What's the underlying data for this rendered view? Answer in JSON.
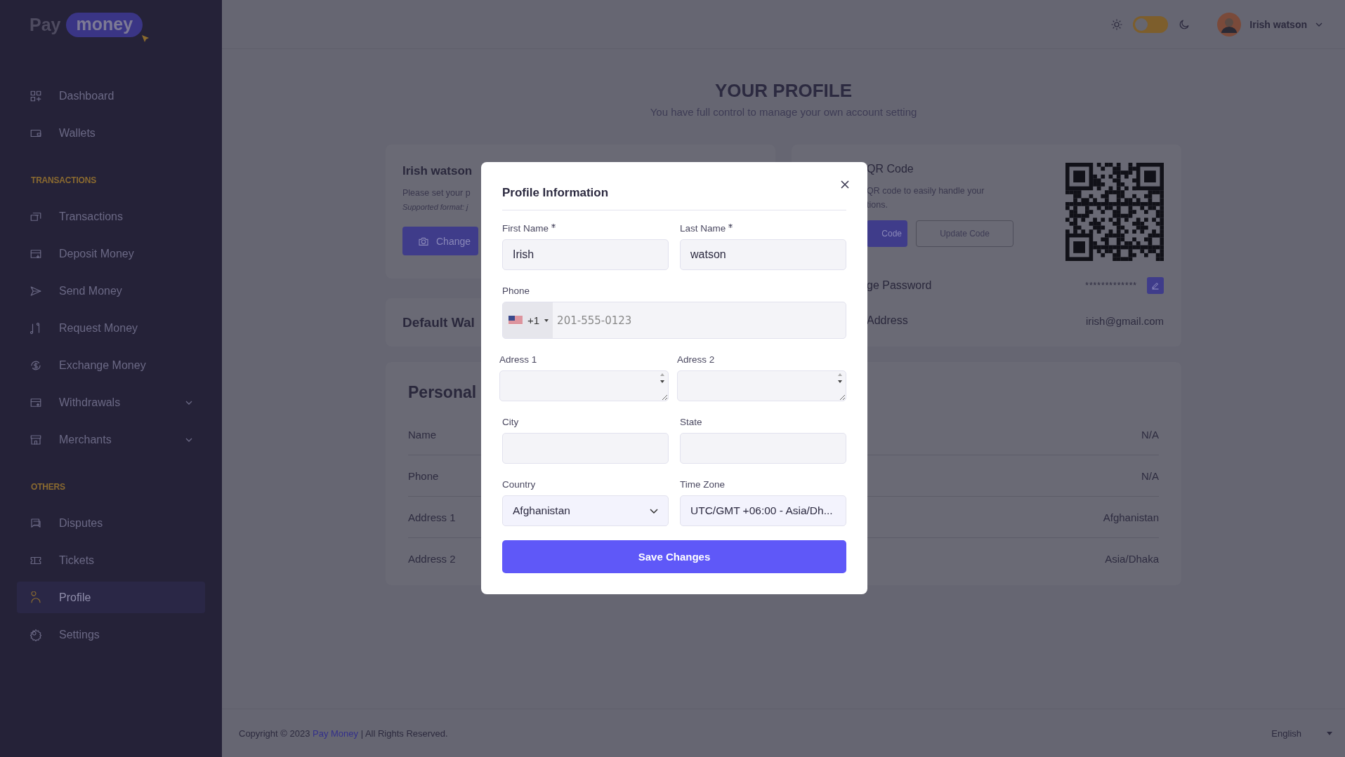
{
  "brand": {
    "word_1": "Pay",
    "word_2": "money"
  },
  "sidebar": {
    "sections": [
      {
        "items": [
          {
            "label": "Dashboard",
            "kind": "link",
            "selected": false
          },
          {
            "label": "Wallets",
            "kind": "link",
            "selected": false
          }
        ]
      },
      {
        "heading": "TRANSACTIONS",
        "items": [
          {
            "label": "Transactions",
            "kind": "link",
            "selected": false
          },
          {
            "label": "Deposit Money",
            "kind": "link",
            "selected": false
          },
          {
            "label": "Send Money",
            "kind": "link",
            "selected": false
          },
          {
            "label": "Request Money",
            "kind": "link",
            "selected": false
          },
          {
            "label": "Exchange Money",
            "kind": "link",
            "selected": false
          },
          {
            "label": "Withdrawals",
            "kind": "dropdown",
            "selected": false
          },
          {
            "label": "Merchants",
            "kind": "dropdown",
            "selected": false
          }
        ]
      },
      {
        "heading": "OTHERS",
        "items": [
          {
            "label": "Disputes",
            "kind": "link",
            "selected": false
          },
          {
            "label": "Tickets",
            "kind": "link",
            "selected": false
          },
          {
            "label": "Profile",
            "kind": "link",
            "selected": true
          },
          {
            "label": "Settings",
            "kind": "link",
            "selected": false
          }
        ]
      }
    ]
  },
  "header": {
    "theme_toggle": {
      "on": false
    },
    "user": {
      "name": "Irish watson"
    }
  },
  "page": {
    "title": "YOUR PROFILE",
    "subtitle": "You have full control to manage your own account setting"
  },
  "profile_card": {
    "name": "Irish watson",
    "hint": "Please set your p",
    "format_note": "Supported format: j",
    "button": "Change"
  },
  "wallet_card": {
    "title": "Default Wal"
  },
  "personal_card": {
    "title": "Personal",
    "rows": [
      {
        "label": "Name",
        "value": "N/A"
      },
      {
        "label": "Phone",
        "value": "N/A"
      },
      {
        "label": "Address 1",
        "value": "Afghanistan"
      },
      {
        "label": "Address 2",
        "value": "Asia/Dhaka"
      }
    ]
  },
  "qr_card": {
    "title": "QR Code",
    "description_lines": [
      "QR code to easily handle your",
      "tions."
    ],
    "primary_button": "Code",
    "secondary_button": "Update Code",
    "rows": [
      {
        "kind": "password",
        "label": "ge Password",
        "value": "*************"
      },
      {
        "kind": "email",
        "label": "Address",
        "value": "irish@gmail.com"
      }
    ]
  },
  "modal": {
    "title": "Profile Information",
    "fields": [
      {
        "kind": "text",
        "label": "First Name",
        "required": true,
        "value": "Irish"
      },
      {
        "kind": "text",
        "label": "Last Name",
        "required": true,
        "value": "watson"
      },
      {
        "kind": "phone",
        "label": "Phone",
        "required": false,
        "dial_code": "+1",
        "placeholder": "201-555-0123"
      },
      {
        "kind": "textarea",
        "label": "Adress 1",
        "required": false
      },
      {
        "kind": "textarea",
        "label": "Adress 2",
        "required": false
      },
      {
        "kind": "text",
        "label": "City",
        "required": false
      },
      {
        "kind": "text",
        "label": "State",
        "required": false
      },
      {
        "kind": "select",
        "label": "Country",
        "required": false,
        "value": "Afghanistan"
      },
      {
        "kind": "plain_select",
        "label": "Time Zone",
        "required": false,
        "value": "UTC/GMT +06:00 - Asia/Dh..."
      }
    ],
    "submit": "Save Changes"
  },
  "footer": {
    "text_before": "Copyright © 2023",
    "link": "Pay Money",
    "text_after": "| All Rights Reserved.",
    "language": "English"
  }
}
